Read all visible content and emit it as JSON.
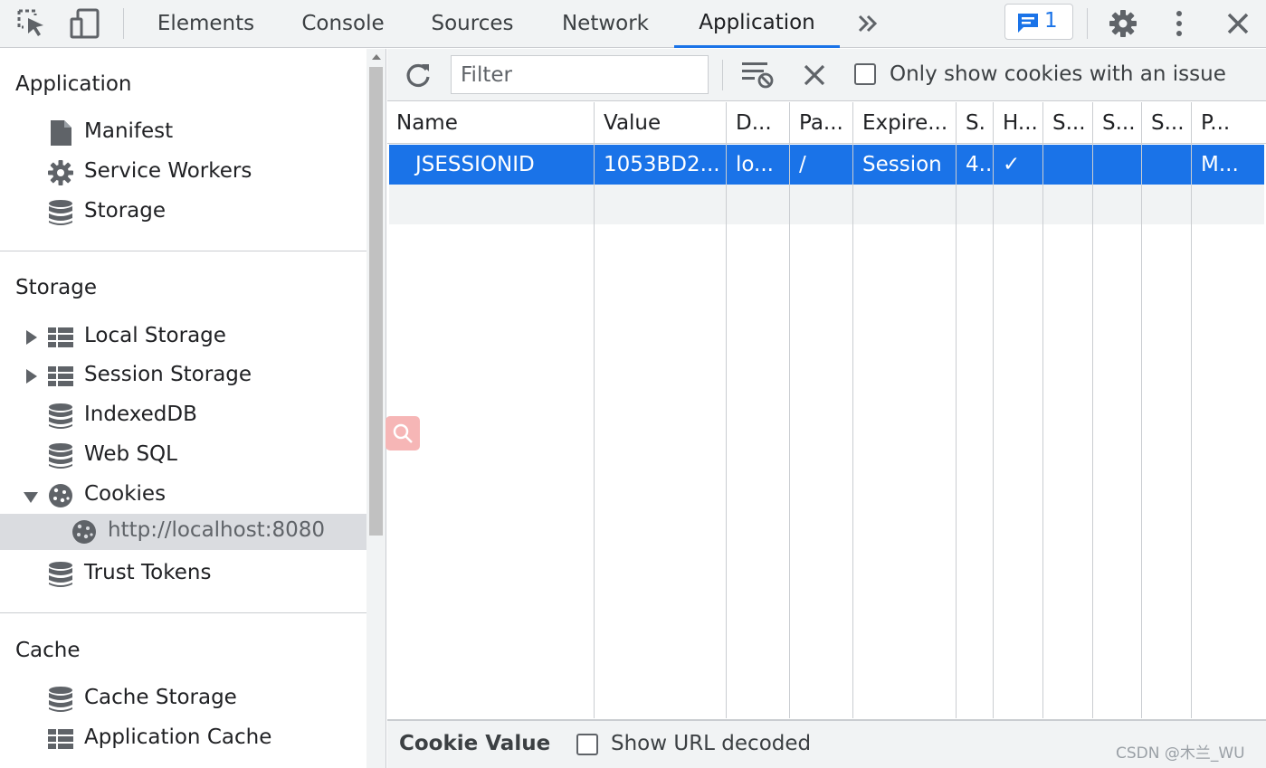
{
  "toolbar": {
    "tabs": [
      {
        "label": "Elements",
        "active": false
      },
      {
        "label": "Console",
        "active": false
      },
      {
        "label": "Sources",
        "active": false
      },
      {
        "label": "Network",
        "active": false
      },
      {
        "label": "Application",
        "active": true
      }
    ],
    "issues_count": "1",
    "accent_color": "#1a73e8"
  },
  "sidebar": {
    "application": {
      "title": "Application",
      "items": [
        {
          "label": "Manifest",
          "icon": "document-icon"
        },
        {
          "label": "Service Workers",
          "icon": "gear-icon"
        },
        {
          "label": "Storage",
          "icon": "database-icon"
        }
      ]
    },
    "storage": {
      "title": "Storage",
      "items": [
        {
          "label": "Local Storage",
          "icon": "table-icon"
        },
        {
          "label": "Session Storage",
          "icon": "table-icon"
        },
        {
          "label": "IndexedDB",
          "icon": "database-icon"
        },
        {
          "label": "Web SQL",
          "icon": "database-icon"
        },
        {
          "label": "Cookies",
          "icon": "cookie-icon"
        },
        {
          "label": "http://localhost:8080",
          "icon": "cookie-icon"
        },
        {
          "label": "Trust Tokens",
          "icon": "database-icon"
        }
      ]
    },
    "cache": {
      "title": "Cache",
      "items": [
        {
          "label": "Cache Storage",
          "icon": "database-icon"
        },
        {
          "label": "Application Cache",
          "icon": "table-icon"
        }
      ]
    }
  },
  "cookies_panel": {
    "filter_placeholder": "Filter",
    "only_issue_label": "Only show cookies with an issue",
    "columns": [
      "Name",
      "Value",
      "D...",
      "Pa...",
      "Expire...",
      "S.",
      "H...",
      "S...",
      "S...",
      "S...",
      "P..."
    ],
    "rows": [
      {
        "cells": [
          "JSESSIONID",
          "1053BD2...",
          "lo...",
          "/",
          "Session",
          "4...",
          "✓",
          "",
          "",
          "",
          "M..."
        ]
      }
    ],
    "cookie_value_title": "Cookie Value",
    "show_url_decoded_label": "Show URL decoded"
  },
  "watermark": "CSDN @木兰_WU"
}
